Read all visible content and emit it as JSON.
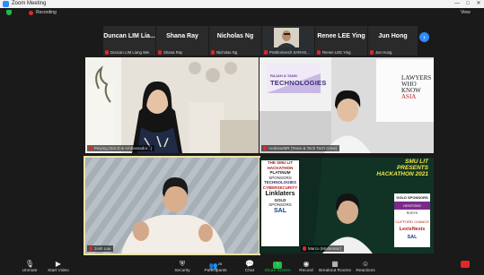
{
  "window": {
    "title": "Zoom Meeting",
    "controls": [
      "—",
      "□",
      "✕"
    ]
  },
  "status": {
    "recording_label": "Recording",
    "view_label": "View"
  },
  "strip": [
    {
      "name": "Duncan LIM Lia...",
      "tag": "Duncan LIM Liang Wei"
    },
    {
      "name": "Shana Ray",
      "tag": "Shana Ray"
    },
    {
      "name": "Nicholas Ng",
      "tag": "Nicholas Ng"
    },
    {
      "name": "",
      "tag": "Prathomvech SARAS..."
    },
    {
      "name": "Renee LEE Ying",
      "tag": "Renee LEE Ying"
    },
    {
      "name": "Jun Hong",
      "tag": "Jun Hong"
    }
  ],
  "strip_next_icon": "›",
  "gallery": [
    {
      "tag": "Peiying (Snr.D & Ambassador...)"
    },
    {
      "tag": "Andrew/MR (Team & Tech Tech Crew)"
    },
    {
      "tag": "Josh Lau"
    },
    {
      "tag": "Marco (Moderator)"
    }
  ],
  "slides": {
    "tech": {
      "line1": "RAJAH & TANN",
      "line2": "TECHNOLOGIES"
    },
    "lawyers": {
      "line1": "LAWYERS",
      "line2": "WHO",
      "line3": "KNOW",
      "line4": "ASIA"
    },
    "hackathon": {
      "title1": "SMU LIT",
      "title2": "PRESENTS",
      "title3": "HACKATHON 2021"
    },
    "poster_lines": [
      "THE SMU LIT",
      "HACKATHON",
      "PLATINUM",
      "SPONSORS",
      "TECHNOLOGIES",
      "CYBERSECURITY",
      "Linklaters",
      "GOLD",
      "SPONSORS",
      "SAL"
    ],
    "sponsors": [
      "GOLD SPONSORS",
      "DENTONS",
      "RODYK",
      "CLIFFORD CHANCE",
      "LexisNexis",
      "SAL"
    ]
  },
  "toolbar": {
    "unmute": "Unmute",
    "start_video": "Start Video",
    "security": "Security",
    "participants": "Participants",
    "participants_count": "25",
    "chat": "Chat",
    "share_screen": "Share Screen",
    "record": "Record",
    "breakout": "Breakout Rooms",
    "reactions": "Reactions"
  },
  "colors": {
    "accent_blue": "#2d8cff",
    "share_green": "#22b84c",
    "muted_red": "#e02828",
    "active_speaker": "#e9e3a4"
  }
}
